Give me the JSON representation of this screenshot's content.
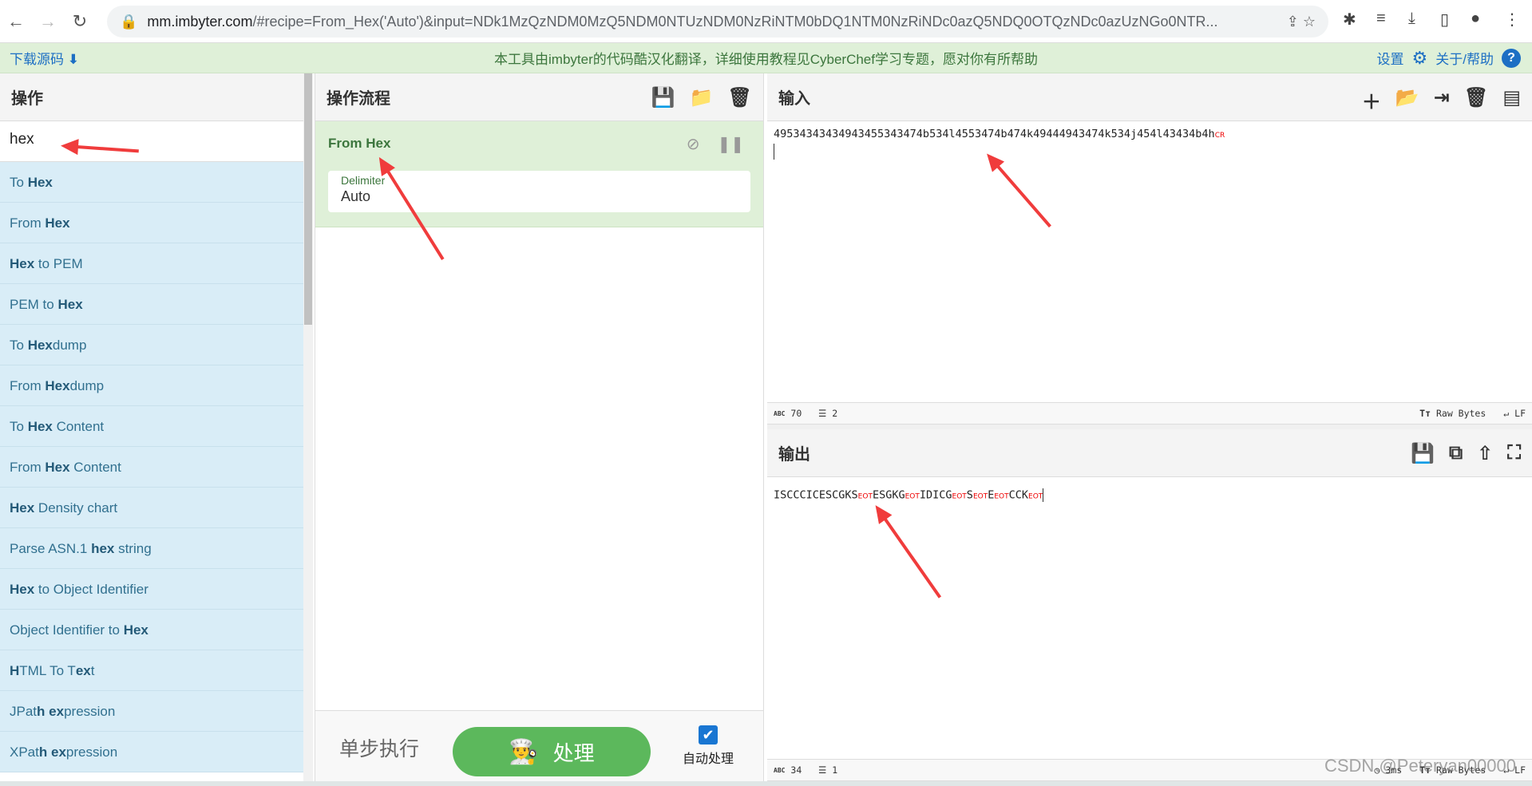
{
  "browser": {
    "url_host": "mm.imbyter.com",
    "url_rest": "/#recipe=From_Hex('Auto')&input=NDk1MzQzNDM0MzQ5NDM0NTUzNDM0NzRiNTM0bDQ1NTM0NzRiNDc0azQ5NDQ0OTQzNDc0azUzNGo0NTR..."
  },
  "banner": {
    "download": "下载源码",
    "center": "本工具由imbyter的代码酷汉化翻译，详细使用教程见CyberChef学习专题，愿对你有所帮助",
    "settings": "设置",
    "about": "关于/帮助"
  },
  "operations": {
    "title": "操作",
    "search_value": "hex",
    "items": [
      [
        [
          "To ",
          0
        ],
        [
          "Hex",
          1
        ]
      ],
      [
        [
          "From ",
          0
        ],
        [
          "Hex",
          1
        ]
      ],
      [
        [
          "Hex",
          1
        ],
        [
          " to PEM",
          0
        ]
      ],
      [
        [
          "PEM to ",
          0
        ],
        [
          "Hex",
          1
        ]
      ],
      [
        [
          "To ",
          0
        ],
        [
          "Hex",
          1
        ],
        [
          "dump",
          0
        ]
      ],
      [
        [
          "From ",
          0
        ],
        [
          "Hex",
          1
        ],
        [
          "dump",
          0
        ]
      ],
      [
        [
          "To ",
          0
        ],
        [
          "Hex",
          1
        ],
        [
          " Content",
          0
        ]
      ],
      [
        [
          "From ",
          0
        ],
        [
          "Hex",
          1
        ],
        [
          " Content",
          0
        ]
      ],
      [
        [
          "Hex",
          1
        ],
        [
          " Density chart",
          0
        ]
      ],
      [
        [
          "Parse ASN.1 ",
          0
        ],
        [
          "hex",
          1
        ],
        [
          " string",
          0
        ]
      ],
      [
        [
          "Hex",
          1
        ],
        [
          " to Object Identifier",
          0
        ]
      ],
      [
        [
          "Object Identifier to ",
          0
        ],
        [
          "Hex",
          1
        ]
      ],
      [
        [
          "H",
          1
        ],
        [
          "TML To T",
          0
        ],
        [
          "ex",
          1
        ],
        [
          "t",
          0
        ]
      ],
      [
        [
          "JPat",
          0
        ],
        [
          "h",
          1
        ],
        [
          " ",
          0
        ],
        [
          "ex",
          1
        ],
        [
          "pression",
          0
        ]
      ],
      [
        [
          "XPat",
          0
        ],
        [
          "h",
          1
        ],
        [
          " ",
          0
        ],
        [
          "ex",
          1
        ],
        [
          "pression",
          0
        ]
      ]
    ]
  },
  "recipe": {
    "title": "操作流程",
    "operation": {
      "name": "From Hex",
      "field_label": "Delimiter",
      "field_value": "Auto"
    },
    "step_label": "单步执行",
    "bake_label": "处理",
    "auto_bake_label": "自动处理",
    "auto_bake_checked": true
  },
  "input": {
    "title": "输入",
    "value": "49534343434943455343474b534l4553474b474k49444943474k534j454l43434b4h",
    "ctrl": "CR",
    "status": {
      "length": "70",
      "lines": "2",
      "encoding": "Raw Bytes",
      "eol": "LF"
    }
  },
  "output": {
    "title": "输出",
    "segments": [
      [
        "ISCCCICESCGKS",
        0
      ],
      [
        "EOT",
        1
      ],
      [
        "ESGKG",
        0
      ],
      [
        "EOT",
        1
      ],
      [
        "IDICG",
        0
      ],
      [
        "EOT",
        1
      ],
      [
        "S",
        0
      ],
      [
        "EOT",
        1
      ],
      [
        "E",
        0
      ],
      [
        "EOT",
        1
      ],
      [
        "CCK",
        0
      ],
      [
        "EOT",
        1
      ]
    ],
    "status": {
      "length": "34",
      "lines": "1",
      "time": "3ms",
      "encoding": "Raw Bytes",
      "eol": "LF"
    }
  },
  "watermark": "CSDN @Peteryan00000",
  "colors": {
    "accent": "#5cb85c",
    "banner": "#dff0d8",
    "op_list": "#d9edf7",
    "control_char": "#ee0000",
    "annotation_arrow": "#f03c3c"
  }
}
